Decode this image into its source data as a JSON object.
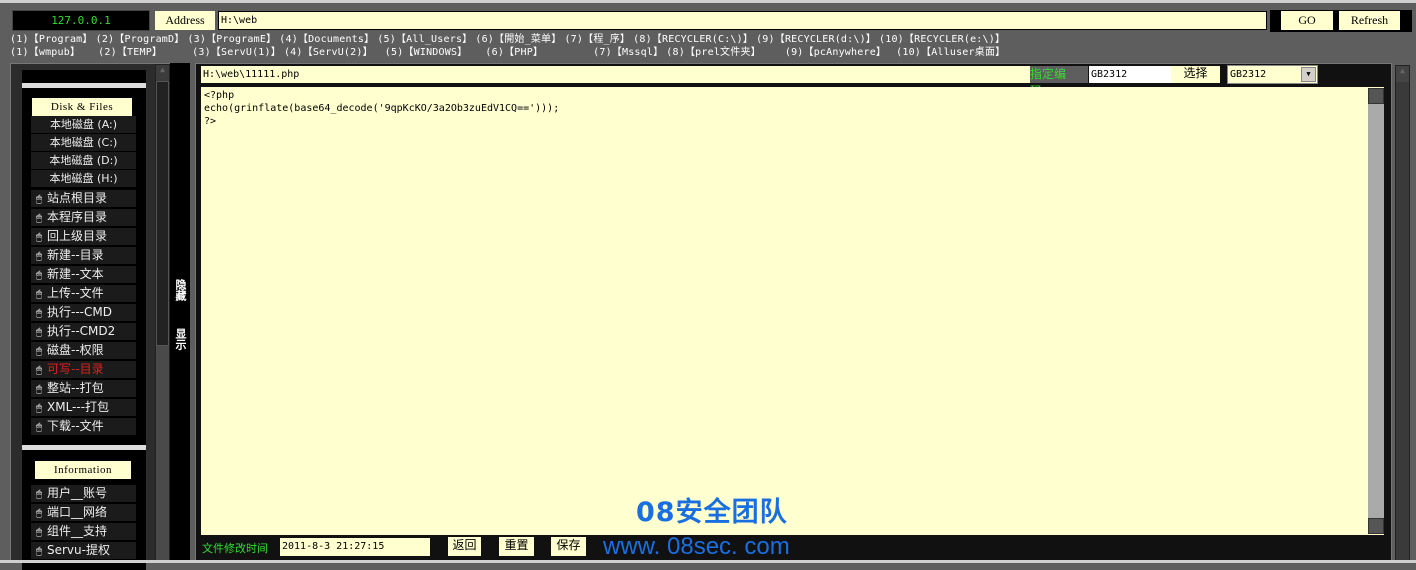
{
  "top": {
    "ip": "127.0.0.1",
    "address_label": "Address",
    "address_value": "H:\\web",
    "go_label": "GO",
    "refresh_label": "Refresh"
  },
  "quick_links_row1": [
    "(1)【Program】",
    "(2)【ProgramD】",
    "(3)【ProgramE】",
    "(4)【Documents】",
    "(5)【All_Users】",
    "(6)【開始_菜单】",
    "(7)【程_序】",
    "(8)【RECYCLER(C:\\)】",
    "(9)【RECYCLER(d:\\)】",
    "(10)【RECYCLER(e:\\)】"
  ],
  "quick_links_row2": [
    "(1)【wmpub】",
    "(2)【TEMP】",
    "(3)【ServU(1)】",
    "(4)【ServU(2)】",
    "(5)【WINDOWS】",
    "(6)【PHP】",
    "(7)【Mssql】",
    "(8)【prel文件夹】",
    "(9)【pcAnywhere】",
    "(10)【Alluser桌面】"
  ],
  "sidebar": {
    "disk_header": "Disk & Files",
    "disks": [
      "本地磁盘 (A:)",
      "本地磁盘 (C:)",
      "本地磁盘 (D:)",
      "本地磁盘 (H:)"
    ],
    "items": [
      {
        "label": "站点根目录"
      },
      {
        "label": "本程序目录"
      },
      {
        "label": "回上级目录"
      },
      {
        "label": "新建--目录"
      },
      {
        "label": "新建--文本"
      },
      {
        "label": "上传--文件"
      },
      {
        "label": "执行---CMD"
      },
      {
        "label": "执行--CMD2"
      },
      {
        "label": "磁盘--权限"
      },
      {
        "label": "可写--目录",
        "highlight": "#e02020"
      },
      {
        "label": "整站--打包"
      },
      {
        "label": "XML---打包"
      },
      {
        "label": "下载--文件"
      }
    ],
    "info_header": "Information",
    "info_items": [
      {
        "label": "用户__账号"
      },
      {
        "label": "端口__网络"
      },
      {
        "label": "组件__支持"
      },
      {
        "label": "Servu-提权"
      }
    ],
    "hide_label": "隐藏",
    "show_label": "显示",
    "item_icon": "mouse-icon"
  },
  "editor": {
    "path": "H:\\web\\11111.php",
    "encoding_label": "指定编码：",
    "encoding_value": "GB2312",
    "choose_label": "选择",
    "encoding_select": "GB2312",
    "content": "<?php\necho(grinflate(base64_decode('9qpKcKO/3a2Ob3zuEdV1CQ==')));\n?>",
    "modified_label": "文件修改时间",
    "modified_value": "2011-8-3 21:27:15",
    "back_label": "返回",
    "reset_label": "重置",
    "save_label": "保存"
  },
  "watermark": {
    "title": "08安全团队",
    "url": "www. 08sec. com",
    "color": "#1a6fe0"
  },
  "colors": {
    "green": "#33dd33",
    "cream": "#ffffd0",
    "highlight": "#e02020"
  }
}
